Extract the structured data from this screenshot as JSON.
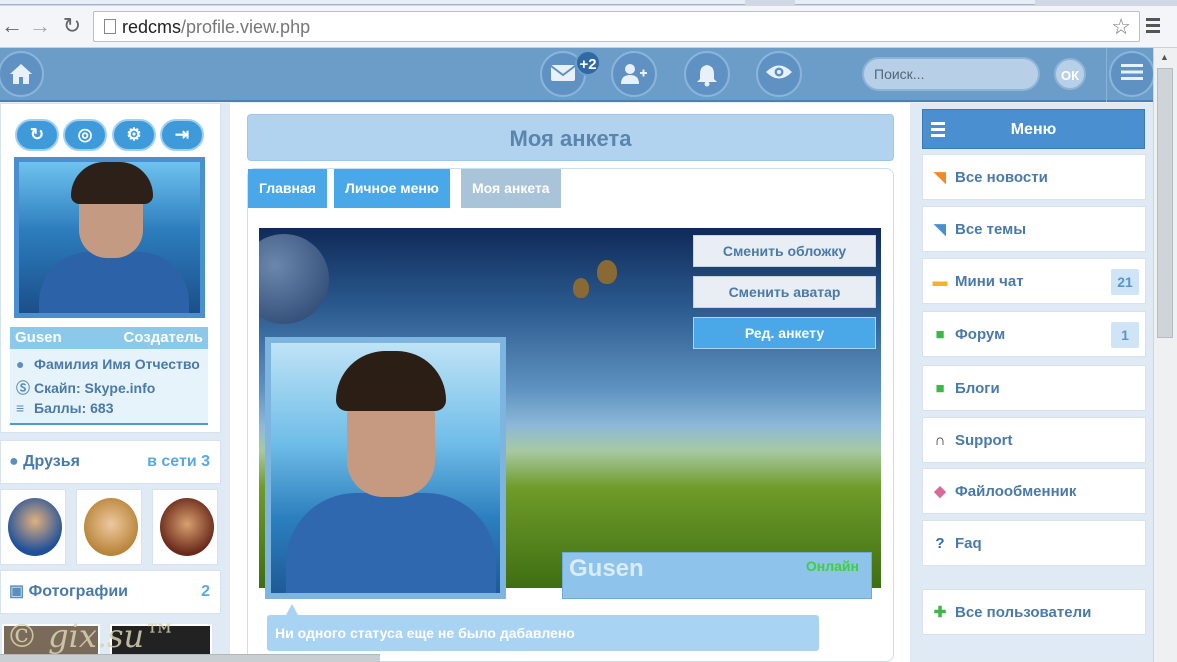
{
  "browser": {
    "url_host": "redcms",
    "url_path": "/profile.view.php"
  },
  "header": {
    "messages_badge": "+2",
    "search_placeholder": "Поиск...",
    "ok_label": "ОК"
  },
  "profile_sidebar": {
    "username": "Gusen",
    "role": "Создатель",
    "full_name": "Фамилия Имя Отчество",
    "skype": "Скайп: Skype.info",
    "points": "Баллы: 683",
    "friends_title": "Друзья",
    "friends_online": "в сети 3",
    "photos_title": "Фотографии",
    "photos_count": "2",
    "watermark": "© gix.su™"
  },
  "main": {
    "title": "Моя анкета",
    "tabs": [
      {
        "label": "Главная"
      },
      {
        "label": "Личное меню"
      },
      {
        "label": "Моя анкета"
      }
    ],
    "cover_buttons": {
      "change_cover": "Сменить обложку",
      "change_avatar": "Сменить аватар",
      "edit_profile": "Ред. анкету"
    },
    "card_name": "Gusen",
    "card_status": "Онлайн",
    "status_text": "Ни одного статуса еще не было дабавлено"
  },
  "right_menu": {
    "title": "Меню",
    "items": [
      {
        "label": "Все новости",
        "icon": "rss-icon",
        "count": ""
      },
      {
        "label": "Все темы",
        "icon": "rss-icon",
        "count": ""
      },
      {
        "label": "Мини чат",
        "icon": "chat-icon",
        "count": "21"
      },
      {
        "label": "Форум",
        "icon": "forum-icon",
        "count": "1"
      },
      {
        "label": "Блоги",
        "icon": "blog-icon",
        "count": ""
      },
      {
        "label": "Support",
        "icon": "headset-icon",
        "count": ""
      },
      {
        "label": "Файлообменник",
        "icon": "files-icon",
        "count": ""
      },
      {
        "label": "Faq",
        "icon": "help-icon",
        "count": ""
      },
      {
        "label": "Все пользователи",
        "icon": "users-icon",
        "count": ""
      }
    ]
  },
  "colors": {
    "header": "#6c9dc9",
    "accent": "#4a8fcf",
    "online": "#3fd13a"
  }
}
